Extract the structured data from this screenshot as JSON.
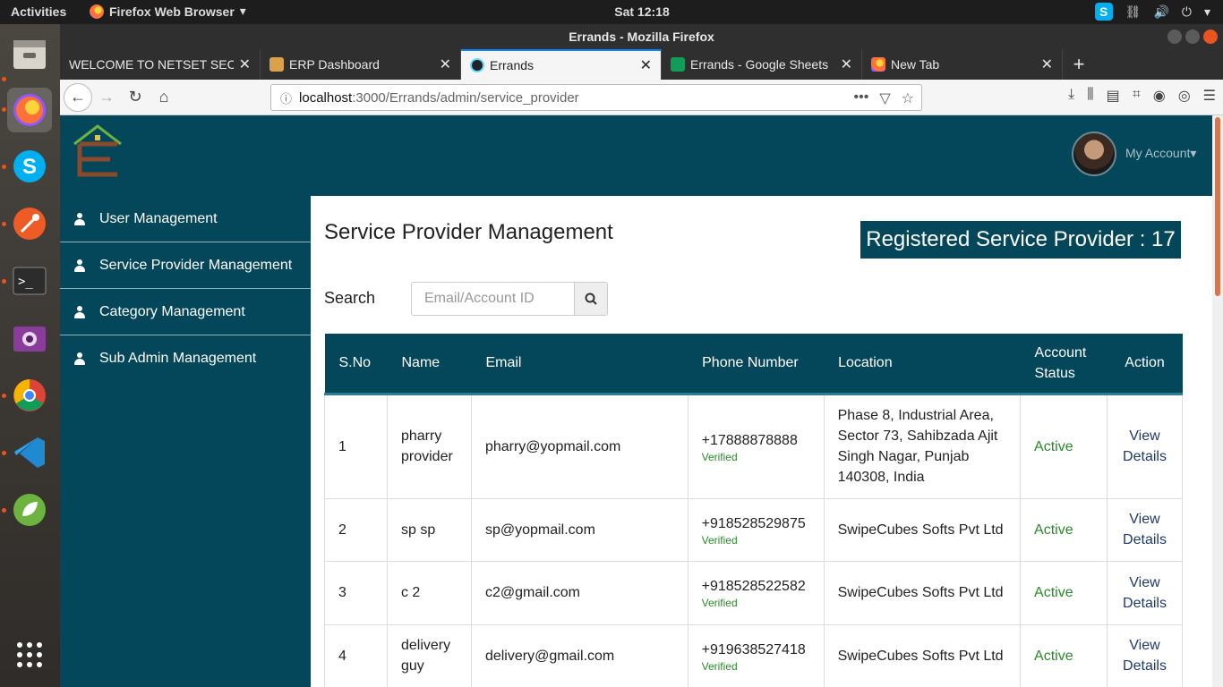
{
  "system": {
    "activities": "Activities",
    "app_name": "Firefox Web Browser",
    "clock": "Sat 12:18"
  },
  "window": {
    "title": "Errands - Mozilla Firefox"
  },
  "tabs": [
    {
      "label": "WELCOME TO NETSET SECU",
      "active": false
    },
    {
      "label": "ERP Dashboard",
      "active": false
    },
    {
      "label": "Errands",
      "active": true
    },
    {
      "label": "Errands - Google Sheets",
      "active": false
    },
    {
      "label": "New Tab",
      "active": false
    }
  ],
  "address_bar": {
    "host": "localhost",
    "path": ":3000/Errands/admin/service_provider"
  },
  "header": {
    "my_account": "My Account"
  },
  "sidebar": {
    "items": [
      {
        "label": "User Management"
      },
      {
        "label": "Service Provider Management"
      },
      {
        "label": "Category Management"
      },
      {
        "label": "Sub Admin Management"
      }
    ]
  },
  "main": {
    "title": "Service Provider Management",
    "count_badge": "Registered Service Provider : 17",
    "search_label": "Search",
    "search_placeholder": "Email/Account ID"
  },
  "table": {
    "headers": [
      "S.No",
      "Name",
      "Email",
      "Phone Number",
      "Location",
      "Account Status",
      "Action"
    ],
    "rows": [
      {
        "sno": "1",
        "name": "pharry provider",
        "email": "pharry@yopmail.com",
        "phone": "+17888878888",
        "phone_status": "Verified",
        "location": "Phase 8, Industrial Area, Sector 73, Sahibzada Ajit Singh Nagar, Punjab 140308, India",
        "status": "Active",
        "action": "View Details"
      },
      {
        "sno": "2",
        "name": "sp sp",
        "email": "sp@yopmail.com",
        "phone": "+918528529875",
        "phone_status": "Verified",
        "location": "SwipeCubes Softs Pvt Ltd",
        "status": "Active",
        "action": "View Details"
      },
      {
        "sno": "3",
        "name": "c 2",
        "email": "c2@gmail.com",
        "phone": "+918528522582",
        "phone_status": "Verified",
        "location": "SwipeCubes Softs Pvt Ltd",
        "status": "Active",
        "action": "View Details"
      },
      {
        "sno": "4",
        "name": "delivery guy",
        "email": "delivery@gmail.com",
        "phone": "+919638527418",
        "phone_status": "Verified",
        "location": "SwipeCubes Softs Pvt Ltd",
        "status": "Active",
        "action": "View Details"
      }
    ]
  },
  "colors": {
    "brand": "#04475a",
    "active_status": "#2a8a2a",
    "accent": "#e95420"
  }
}
